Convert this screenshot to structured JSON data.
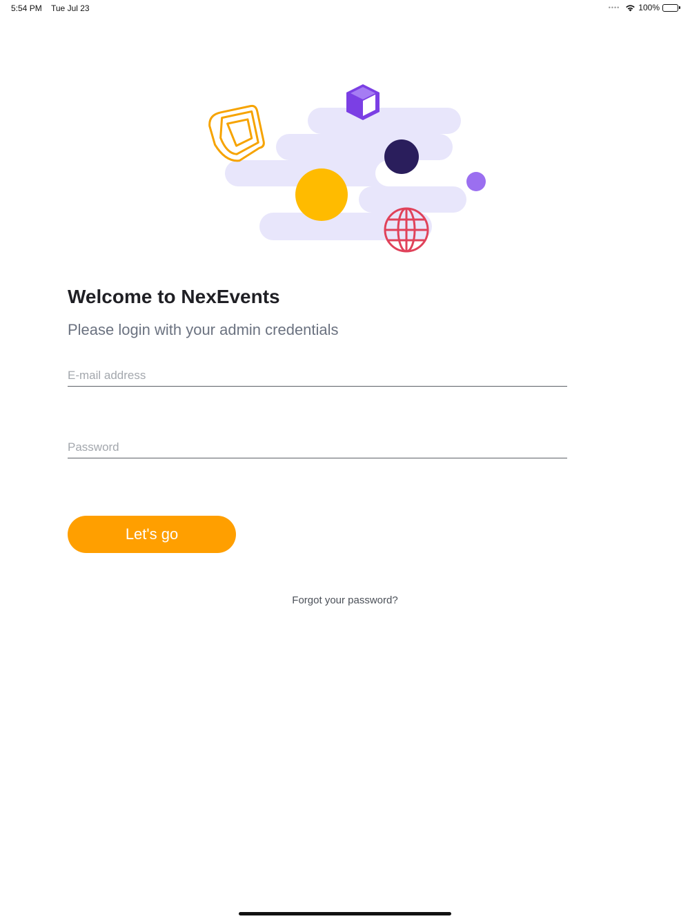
{
  "status_bar": {
    "time": "5:54 PM",
    "date": "Tue Jul 23",
    "battery_percent": "100%",
    "battery_level": 1.0,
    "icons": [
      "wifi-icon",
      "battery-icon"
    ]
  },
  "illustration": {
    "colors": {
      "cloud": "#e8e6fb",
      "monitor": "#f6a300",
      "cube": "#7b3fe4",
      "dark_dot": "#2a1e5c",
      "sun": "#ffbb00",
      "small_dot": "#9b6ff0",
      "globe": "#e0425a"
    },
    "elements": [
      "monitor-icon",
      "cube-icon",
      "globe-icon"
    ]
  },
  "login": {
    "title": "Welcome to NexEvents",
    "subtitle": "Please login with your admin credentials",
    "email_placeholder": "E-mail address",
    "email_value": "",
    "password_placeholder": "Password",
    "password_value": "",
    "submit_label": "Let's go",
    "forgot_label": "Forgot your password?"
  },
  "theme": {
    "accent": "#ff9f00",
    "title_color": "#1f1f24",
    "subtitle_color": "#6b7280"
  }
}
